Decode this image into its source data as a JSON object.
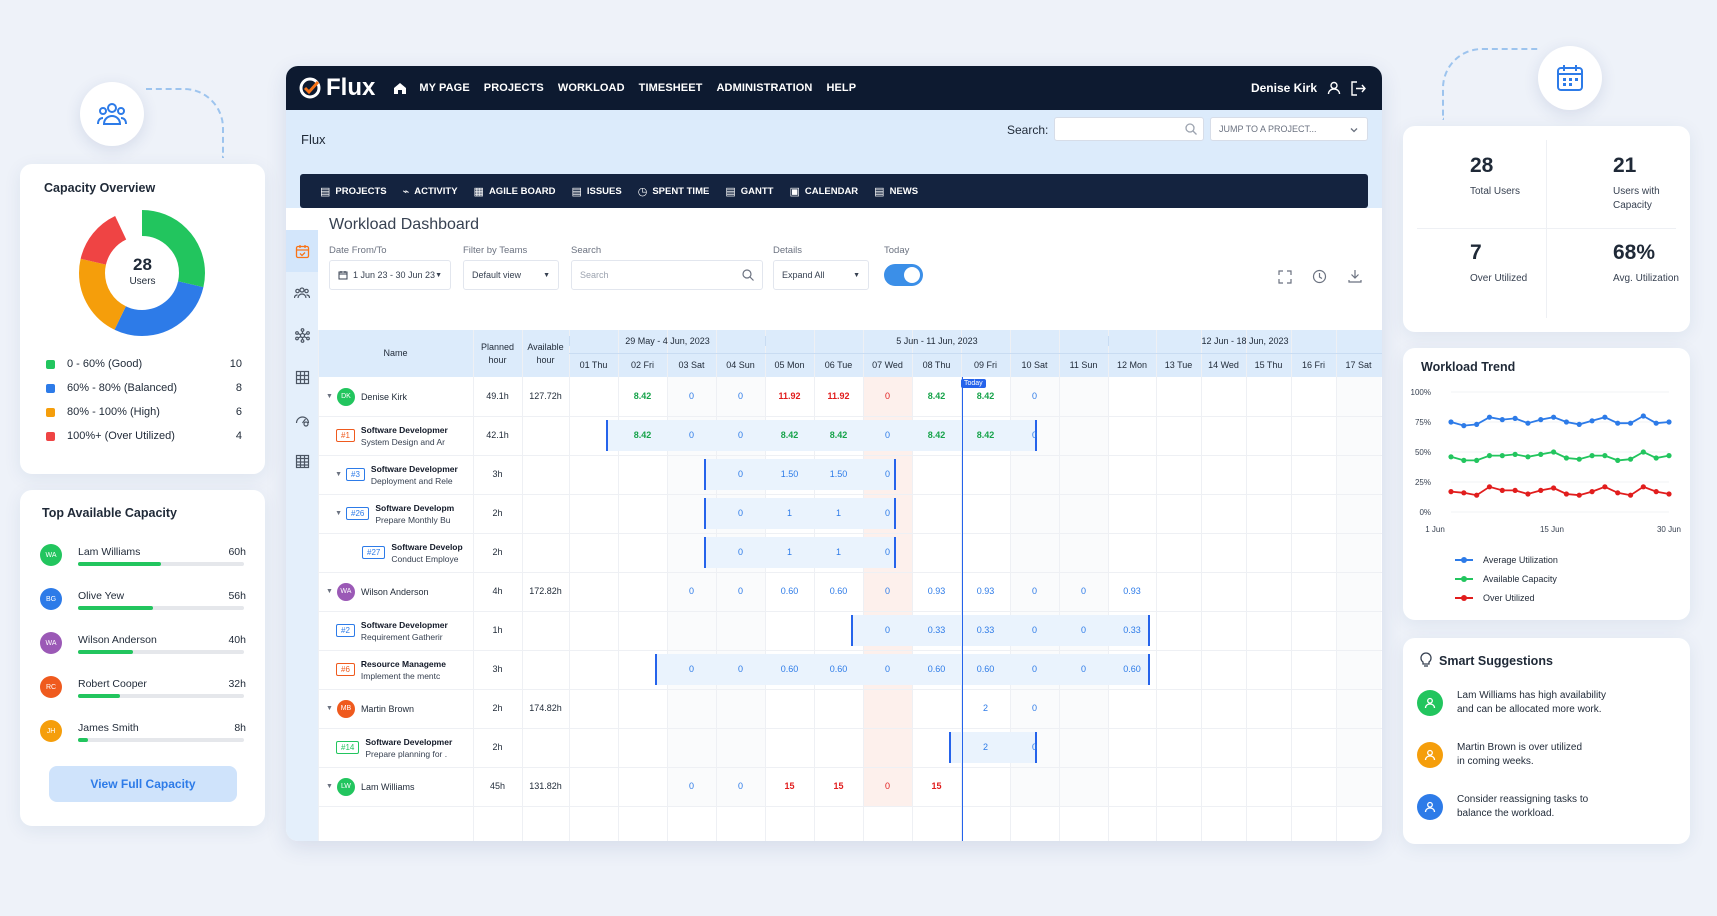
{
  "colors": {
    "good": "#22c55e",
    "balanced": "#2d7be8",
    "high": "#f59e0b",
    "over": "#ef4444",
    "navy": "#0d1a30"
  },
  "capacity": {
    "title": "Capacity Overview",
    "center_value": "28",
    "center_label": "Users",
    "legend": [
      {
        "label": "0 - 60% (Good)",
        "value": "10",
        "color": "#22c55e"
      },
      {
        "label": "60% - 80% (Balanced)",
        "value": "8",
        "color": "#2d7be8"
      },
      {
        "label": "80% - 100% (High)",
        "value": "6",
        "color": "#f59e0b"
      },
      {
        "label": "100%+ (Over Utilized)",
        "value": "4",
        "color": "#ef4444"
      }
    ]
  },
  "top_available": {
    "title": "Top Available Capacity",
    "button": "View Full Capacity",
    "people": [
      {
        "initials": "WA",
        "name": "Lam Williams",
        "hours": "60h",
        "fill": 0.5,
        "color": "#22c55e"
      },
      {
        "initials": "BG",
        "name": "Olive Yew",
        "hours": "56h",
        "fill": 0.45,
        "color": "#2d7be8"
      },
      {
        "initials": "WA",
        "name": "Wilson Anderson",
        "hours": "40h",
        "fill": 0.33,
        "color": "#9b59b6"
      },
      {
        "initials": "RC",
        "name": "Robert Cooper",
        "hours": "32h",
        "fill": 0.25,
        "color": "#ef5a1e"
      },
      {
        "initials": "JH",
        "name": "James Smith",
        "hours": "8h",
        "fill": 0.06,
        "color": "#f59e0b"
      }
    ]
  },
  "stats": [
    {
      "value": "28",
      "label1": "Total Users",
      "label2": "",
      "icon": "users-icon",
      "color": "#2d7be8"
    },
    {
      "value": "21",
      "label1": "Users with",
      "label2": "Capacity",
      "icon": "check-circle-icon",
      "color": "#22c55e"
    },
    {
      "value": "7",
      "label1": "Over Utilized",
      "label2": "",
      "icon": "clock-icon",
      "color": "#f97316"
    },
    {
      "value": "68%",
      "label1": "Avg. Utilization",
      "label2": "",
      "icon": "pie-icon",
      "color": "#6d5ce8"
    }
  ],
  "trend": {
    "title": "Workload Trend",
    "chart_data": {
      "type": "line",
      "y_ticks": [
        "100%",
        "75%",
        "50%",
        "25%",
        "0%"
      ],
      "x_ticks": [
        "1 Jun",
        "15 Jun",
        "30 Jun"
      ],
      "ylim": [
        0,
        100
      ],
      "series": [
        {
          "name": "Average Utilization",
          "color": "#2d7be8",
          "values": [
            75,
            72,
            73,
            79,
            77,
            78,
            74,
            77,
            79,
            75,
            73,
            76,
            79,
            74,
            74,
            80,
            74,
            75
          ]
        },
        {
          "name": "Available Capacity",
          "color": "#22c55e",
          "values": [
            46,
            43,
            43,
            47,
            47,
            48,
            46,
            48,
            50,
            45,
            44,
            47,
            47,
            43,
            44,
            50,
            45,
            47
          ]
        },
        {
          "name": "Over Utilized",
          "color": "#e11d1d",
          "values": [
            17,
            16,
            14,
            21,
            18,
            18,
            15,
            18,
            20,
            15,
            14,
            17,
            21,
            16,
            14,
            21,
            17,
            15
          ]
        }
      ]
    }
  },
  "suggestions": {
    "title": "Smart Suggestions",
    "items": [
      {
        "line1": "Lam Williams has high availability",
        "line2": "and can be allocated more work.",
        "color": "#22c55e"
      },
      {
        "line1": "Martin Brown is over utilized",
        "line2": "in coming weeks.",
        "color": "#f59e0b"
      },
      {
        "line1": "Consider reassigning tasks to",
        "line2": "balance the workload.",
        "color": "#2d7be8"
      }
    ]
  },
  "app": {
    "logo": "Flux",
    "nav": [
      "MY PAGE",
      "PROJECTS",
      "WORKLOAD",
      "TIMESHEET",
      "ADMINISTRATION",
      "HELP"
    ],
    "user": "Denise Kirk",
    "breadcrumb": "Flux",
    "search_label": "Search:",
    "jump": "JUMP TO A PROJECT...",
    "tabs": [
      "PROJECTS",
      "ACTIVITY",
      "AGILE BOARD",
      "ISSUES",
      "SPENT TIME",
      "GANTT",
      "CALENDAR",
      "NEWS"
    ]
  },
  "dashboard": {
    "title": "Workload Dashboard",
    "labels": {
      "date": "Date From/To",
      "teams": "Filter by Teams",
      "search": "Search",
      "details": "Details",
      "today": "Today"
    },
    "date_value": "1 Jun 23 - 30 Jun 23",
    "teams_value": "Default view",
    "search_placeholder": "Search",
    "details_value": "Expand All",
    "today_label": "Today"
  },
  "grid": {
    "col_name": "Name",
    "col_planned1": "Planned",
    "col_planned2": "hour",
    "col_avail1": "Available",
    "col_avail2": "hour",
    "weeks": [
      "29 May - 4 Jun, 2023",
      "5 Jun - 11 Jun, 2023",
      "12 Jun - 18 Jun, 2023"
    ],
    "days": [
      "01 Thu",
      "02 Fri",
      "03 Sat",
      "04 Sun",
      "05 Mon",
      "06 Tue",
      "07 Wed",
      "08 Thu",
      "09 Fri",
      "10 Sat",
      "11 Sun",
      "12 Mon",
      "13 Tue",
      "14 Wed",
      "15 Thu",
      "16 Fri",
      "17 Sat"
    ],
    "rows": [
      {
        "type": "user",
        "indent": 0,
        "initials": "DK",
        "color": "#22c55e",
        "name": "Denise Kirk",
        "planned": "49.1h",
        "avail": "127.72h",
        "vals": [
          "",
          "8.42",
          "0",
          "0",
          "11.92",
          "11.92",
          "0",
          "8.42",
          "8.42",
          "0",
          "",
          "",
          "",
          "",
          "",
          "",
          ""
        ],
        "bar": null
      },
      {
        "type": "task",
        "indent": 1,
        "id": "#1",
        "bcolor": "#ef5a1e",
        "t1": "Software Developmer",
        "t2": "System Design and Ar",
        "planned": "42.1h",
        "avail": "",
        "vals": [
          "",
          "8.42",
          "0",
          "0",
          "8.42",
          "8.42",
          "0",
          "8.42",
          "8.42",
          "0",
          "",
          "",
          "",
          "",
          "",
          "",
          ""
        ],
        "bar": [
          1,
          10
        ]
      },
      {
        "type": "task",
        "indent": 0,
        "id": "#3",
        "bcolor": "#2d7be8",
        "t1": "Software Developmer",
        "t2": "Deployment and Rele",
        "planned": "3h",
        "avail": "",
        "vals": [
          "",
          "",
          "",
          "0",
          "1.50",
          "1.50",
          "0",
          "",
          "",
          "",
          "",
          "",
          "",
          "",
          "",
          "",
          ""
        ],
        "bar": [
          3,
          7
        ],
        "caret": true
      },
      {
        "type": "task",
        "indent": 2,
        "id": "#26",
        "bcolor": "#2d7be8",
        "t1": "Software Developm",
        "t2": "Prepare Monthly Bu",
        "planned": "2h",
        "avail": "",
        "vals": [
          "",
          "",
          "",
          "0",
          "1",
          "1",
          "0",
          "",
          "",
          "",
          "",
          "",
          "",
          "",
          "",
          "",
          ""
        ],
        "bar": [
          3,
          7
        ],
        "caret": true
      },
      {
        "type": "task",
        "indent": 3,
        "id": "#27",
        "bcolor": "#2d7be8",
        "t1": "Software Develop",
        "t2": "Conduct Employe",
        "planned": "2h",
        "avail": "",
        "vals": [
          "",
          "",
          "",
          "0",
          "1",
          "1",
          "0",
          "",
          "",
          "",
          "",
          "",
          "",
          "",
          "",
          "",
          ""
        ],
        "bar": [
          3,
          7
        ]
      },
      {
        "type": "user",
        "indent": 0,
        "initials": "WA",
        "color": "#9b59b6",
        "name": "Wilson Anderson",
        "planned": "4h",
        "avail": "172.82h",
        "vals": [
          "",
          "",
          "0",
          "0",
          "0.60",
          "0.60",
          "0",
          "0.93",
          "0.93",
          "0",
          "0",
          "0.93",
          "",
          "",
          "",
          "",
          ""
        ],
        "bar": null
      },
      {
        "type": "task",
        "indent": 1,
        "id": "#2",
        "bcolor": "#2d7be8",
        "t1": "Software Developmer",
        "t2": "Requirement Gatherir",
        "planned": "1h",
        "avail": "",
        "vals": [
          "",
          "",
          "",
          "",
          "",
          "",
          "0",
          "0.33",
          "0.33",
          "0",
          "0",
          "0.33",
          "",
          "",
          "",
          "",
          ""
        ],
        "bar": [
          6,
          12
        ]
      },
      {
        "type": "task",
        "indent": 1,
        "id": "#6",
        "bcolor": "#ef5a1e",
        "t1": "Resource Manageme",
        "t2": "Implement the mentc",
        "planned": "3h",
        "avail": "",
        "vals": [
          "",
          "",
          "0",
          "0",
          "0.60",
          "0.60",
          "0",
          "0.60",
          "0.60",
          "0",
          "0",
          "0.60",
          "",
          "",
          "",
          "",
          ""
        ],
        "bar": [
          2,
          12
        ]
      },
      {
        "type": "user",
        "indent": 0,
        "initials": "MB",
        "color": "#ef5a1e",
        "name": "Martin Brown",
        "planned": "2h",
        "avail": "174.82h",
        "vals": [
          "",
          "",
          "",
          "",
          "",
          "",
          "",
          "",
          "2",
          "0",
          "",
          "",
          "",
          "",
          "",
          "",
          ""
        ],
        "bar": null
      },
      {
        "type": "task",
        "indent": 1,
        "id": "#14",
        "bcolor": "#22c55e",
        "t1": "Software Developmer",
        "t2": "Prepare planning for .",
        "planned": "2h",
        "avail": "",
        "vals": [
          "",
          "",
          "",
          "",
          "",
          "",
          "",
          "",
          "2",
          "0",
          "",
          "",
          "",
          "",
          "",
          "",
          ""
        ],
        "bar": [
          8,
          10
        ]
      },
      {
        "type": "user",
        "indent": 0,
        "initials": "LW",
        "color": "#22c55e",
        "name": "Lam Williams",
        "planned": "45h",
        "avail": "131.82h",
        "vals": [
          "",
          "",
          "0",
          "0",
          "15",
          "15",
          "0",
          "15",
          "",
          "",
          "",
          "",
          "",
          "",
          "",
          "",
          ""
        ],
        "bar": null
      }
    ]
  }
}
